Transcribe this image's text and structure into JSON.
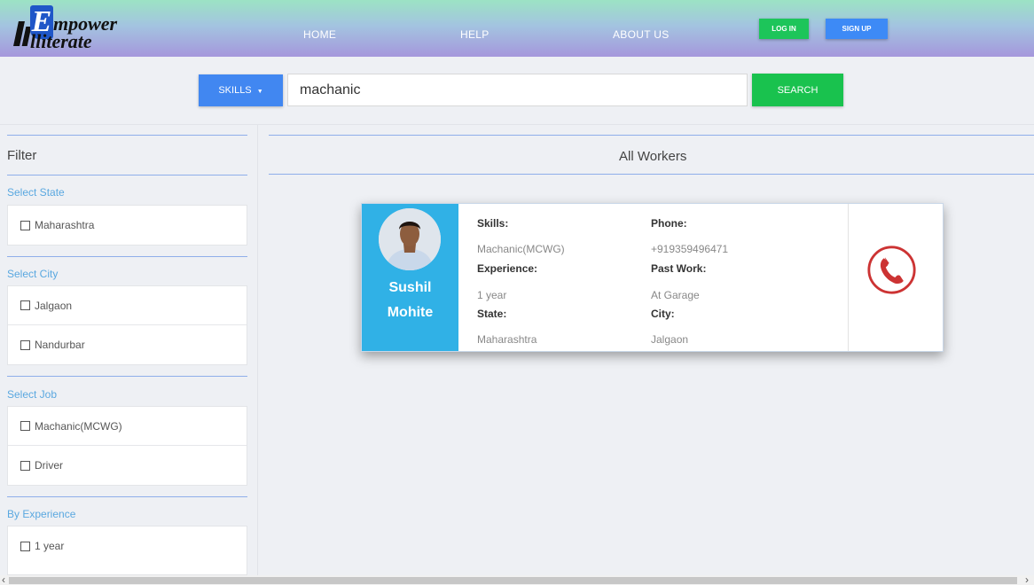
{
  "brand": {
    "line1": "mpower",
    "line2": "lliterate",
    "initial": "E"
  },
  "nav": {
    "home": "HOME",
    "help": "HELP",
    "about": "ABOUT US"
  },
  "auth": {
    "login": "LOG IN",
    "signup": "SIGN UP"
  },
  "search": {
    "skills_label": "SKILLS",
    "query": "machanic",
    "button": "SEARCH"
  },
  "filter": {
    "title": "Filter",
    "sections": [
      {
        "label": "Select State",
        "options": [
          "Maharashtra"
        ]
      },
      {
        "label": "Select City",
        "options": [
          "Jalgaon",
          "Nandurbar"
        ]
      },
      {
        "label": "Select Job",
        "options": [
          "Machanic(MCWG)",
          "Driver"
        ]
      },
      {
        "label": "By Experience",
        "options": [
          "1 year"
        ]
      }
    ]
  },
  "main": {
    "title": "All Workers"
  },
  "worker": {
    "first_name": "Sushil",
    "last_name": "Mohite",
    "skills_label": "Skills:",
    "skills": "Machanic(MCWG)",
    "phone_label": "Phone:",
    "phone": "+919359496471",
    "experience_label": "Experience:",
    "experience": "1 year",
    "past_work_label": "Past Work:",
    "past_work": "At Garage",
    "state_label": "State:",
    "state": "Maharashtra",
    "city_label": "City:",
    "city": "Jalgaon"
  },
  "icons": {
    "call": "phone-call-icon",
    "dropdown": "caret-down-icon"
  },
  "colors": {
    "accent_blue": "#4187f1",
    "accent_green": "#19c24e",
    "card_blue": "#30b1e6",
    "call_red": "#cc3333"
  }
}
